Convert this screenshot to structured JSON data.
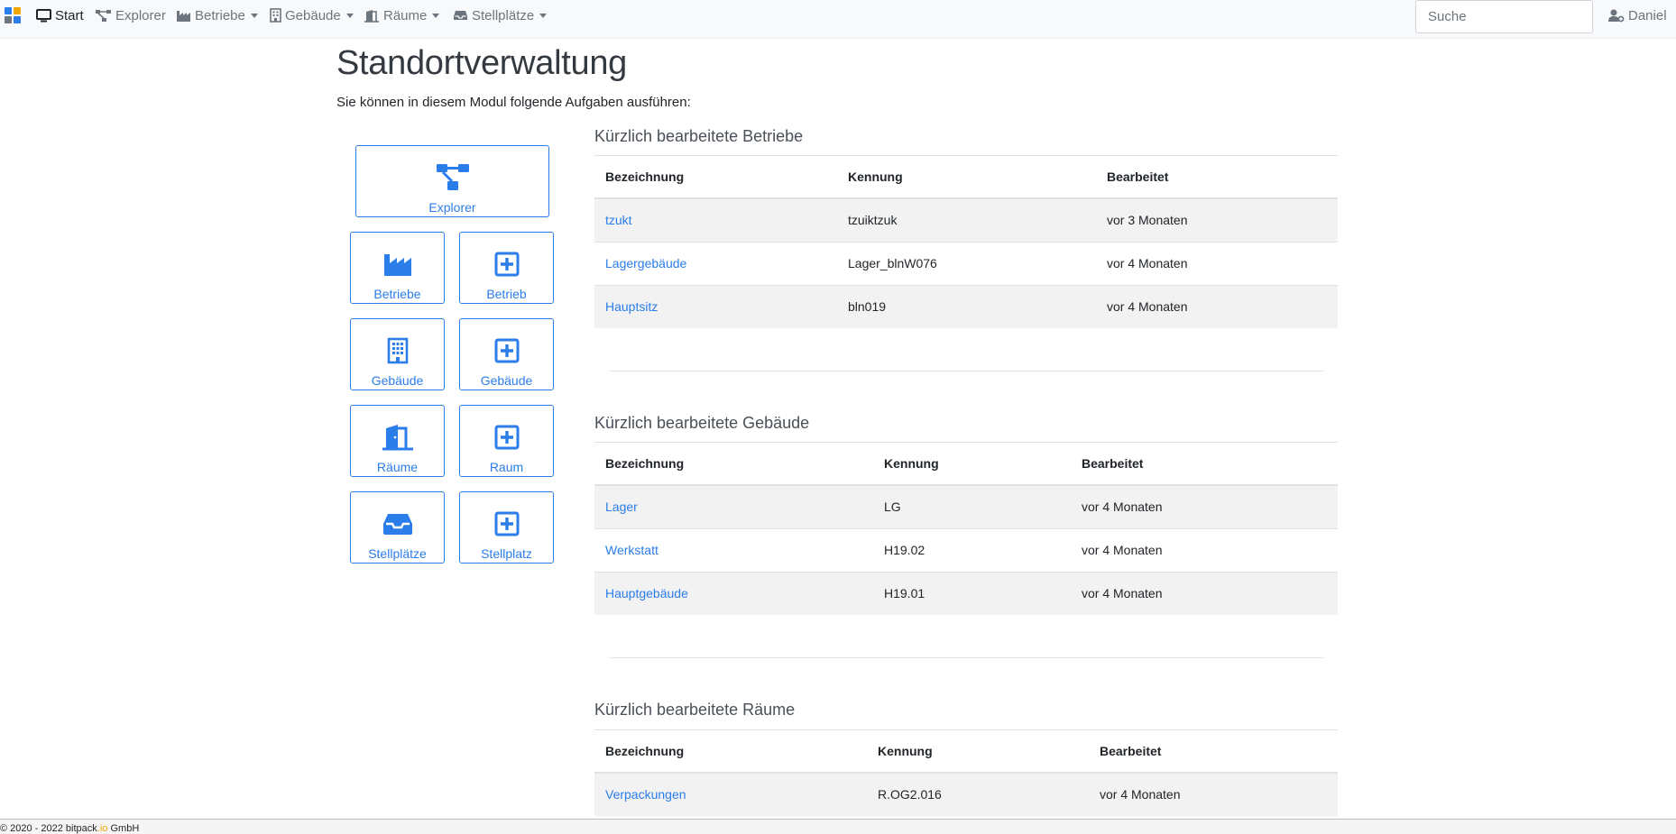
{
  "nav": {
    "items": [
      {
        "label": "Start",
        "icon": "monitor-icon"
      },
      {
        "label": "Explorer",
        "icon": "sitemap-icon"
      },
      {
        "label": "Betriebe",
        "icon": "factory-icon"
      },
      {
        "label": "Gebäude",
        "icon": "building-icon"
      },
      {
        "label": "Räume",
        "icon": "door-icon"
      },
      {
        "label": "Stellplätze",
        "icon": "inbox-icon"
      }
    ],
    "search_placeholder": "Suche",
    "user": "Daniel"
  },
  "colors": {
    "accent": "#2b7de9",
    "navbar_bg": "#f8f9fa"
  },
  "page": {
    "title": "Standortverwaltung",
    "subtitle": "Sie können in diesem Modul folgende Aufgaben ausführen:"
  },
  "tiles": {
    "explorer": "Explorer",
    "betriebe": "Betriebe",
    "betrieb_add": "Betrieb",
    "gebaeude": "Gebäude",
    "gebaeude_add": "Gebäude",
    "raeume": "Räume",
    "raum_add": "Raum",
    "stellplaetze": "Stellplätze",
    "stellplatz_add": "Stellplatz"
  },
  "tables": {
    "betriebe": {
      "title": "Kürzlich bearbeitete Betriebe",
      "headers": [
        "Bezeichnung",
        "Kennung",
        "Bearbeitet"
      ],
      "rows": [
        [
          "tzukt",
          "tzuiktzuk",
          "vor 3 Monaten"
        ],
        [
          "Lagergebäude",
          "Lager_blnW076",
          "vor 4 Monaten"
        ],
        [
          "Hauptsitz",
          "bln019",
          "vor 4 Monaten"
        ]
      ]
    },
    "gebaeude": {
      "title": "Kürzlich bearbeitete Gebäude",
      "headers": [
        "Bezeichnung",
        "Kennung",
        "Bearbeitet"
      ],
      "rows": [
        [
          "Lager",
          "LG",
          "vor 4 Monaten"
        ],
        [
          "Werkstatt",
          "H19.02",
          "vor 4 Monaten"
        ],
        [
          "Hauptgebäude",
          "H19.01",
          "vor 4 Monaten"
        ]
      ]
    },
    "raeume": {
      "title": "Kürzlich bearbeitete Räume",
      "headers": [
        "Bezeichnung",
        "Kennung",
        "Bearbeitet"
      ],
      "rows": [
        [
          "Verpackungen",
          "R.OG2.016",
          "vor 4 Monaten"
        ]
      ]
    }
  },
  "footer": {
    "prefix": "© 2020 - 2022 bitpack",
    "io": ".io",
    "suffix": " GmbH"
  }
}
